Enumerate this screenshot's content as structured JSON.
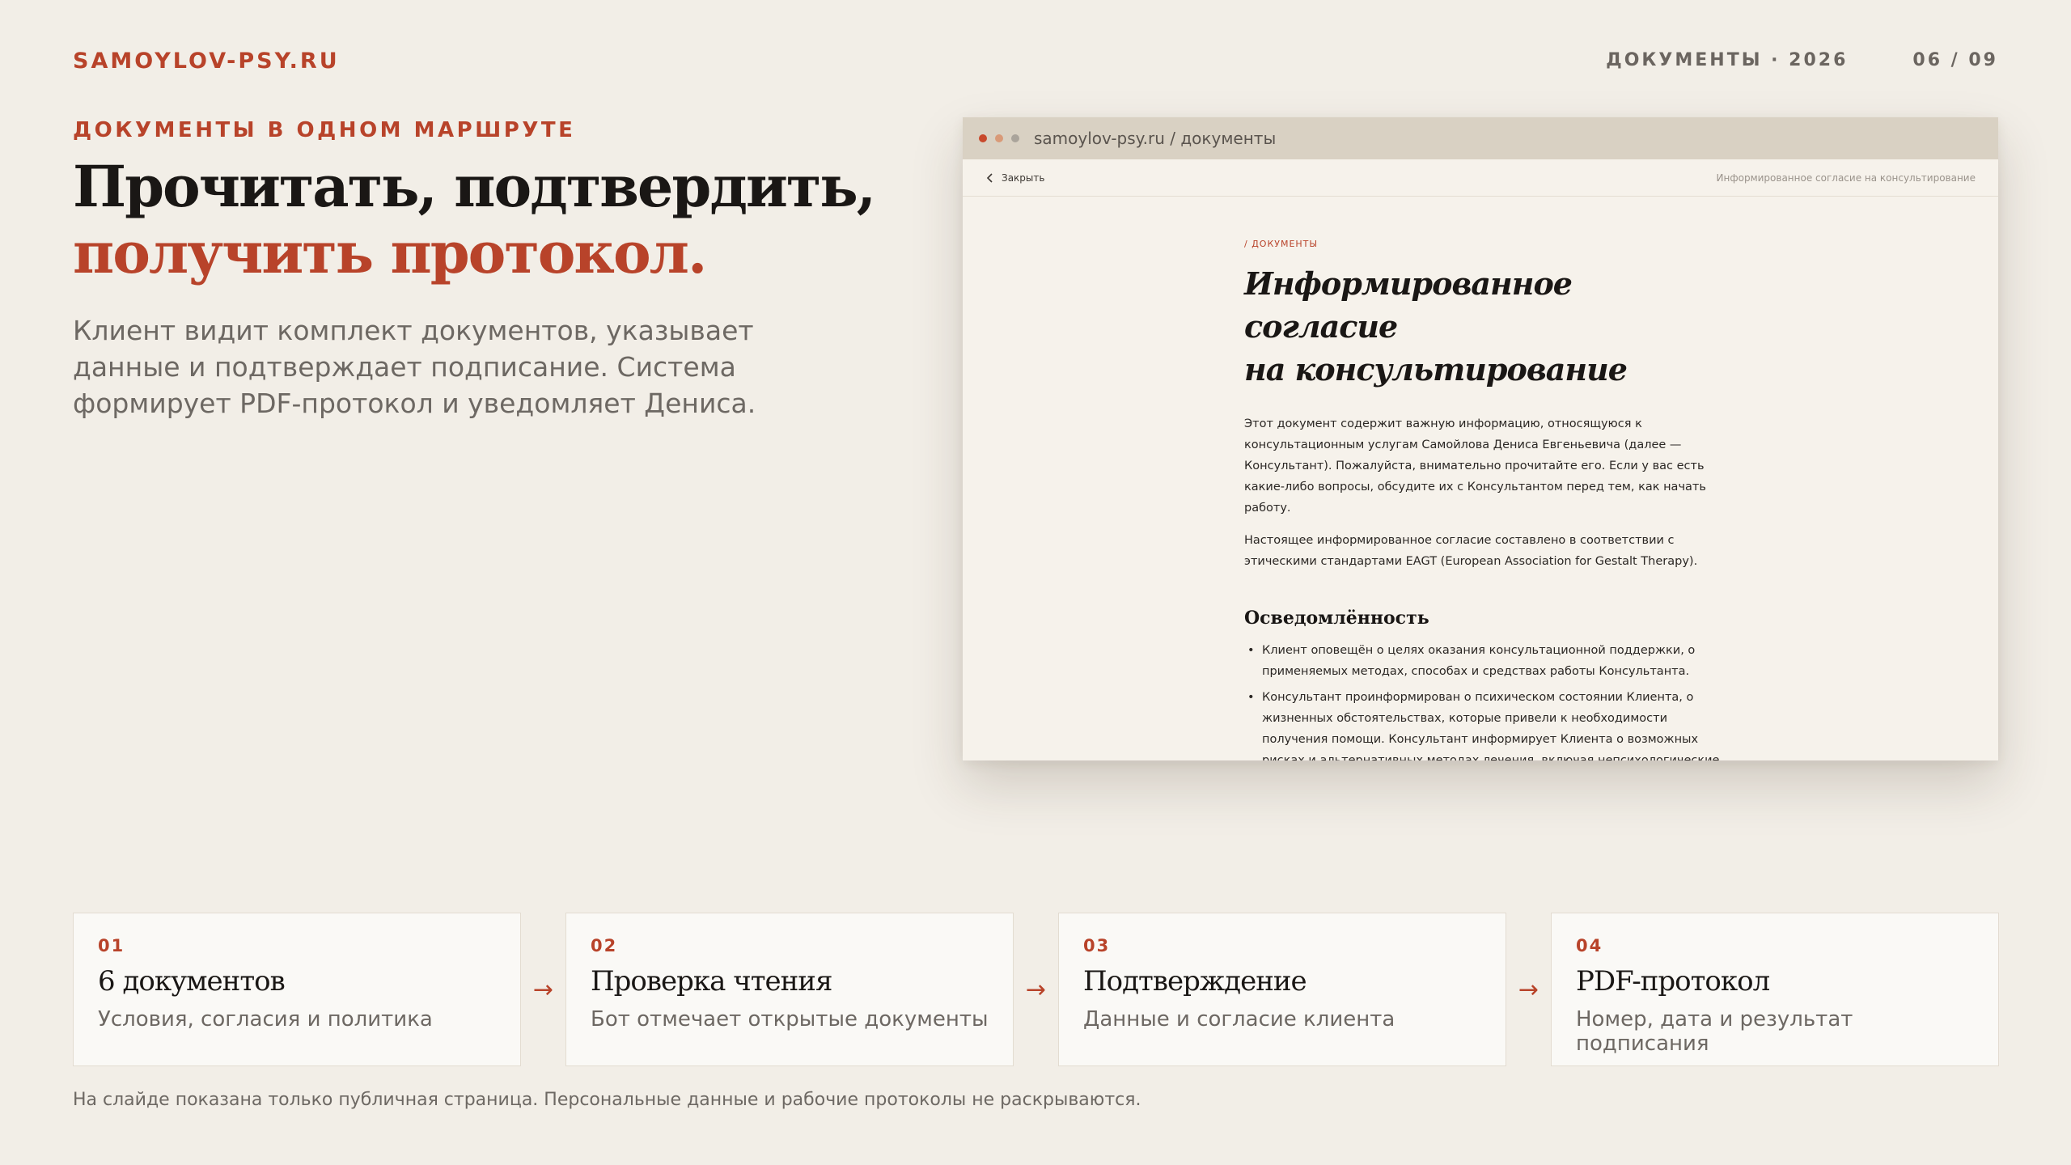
{
  "header": {
    "brand": "SAMOYLOV-PSY.RU",
    "section": "ДОКУМЕНТЫ · 2026",
    "page_counter": "06 / 09"
  },
  "hero": {
    "eyebrow": "ДОКУМЕНТЫ В ОДНОМ МАРШРУТЕ",
    "title_line1": "Прочитать, подтвердить,",
    "title_line2": "получить протокол.",
    "lead": "Клиент видит комплект документов, указывает данные и подтверждает подписание. Система формирует PDF-протокол и уведомляет Дениса."
  },
  "browser": {
    "url": "samoylov-psy.ru / документы",
    "close_label": "Закрыть",
    "doc_name": "Информированное согласие на консультирование",
    "doc": {
      "kicker": "/ ДОКУМЕНТЫ",
      "title_line1": "Информированное согласие",
      "title_line2": "на консультирование",
      "paragraph1": "Этот документ содержит важную информацию, относящуюся к консультационным услугам Самойлова Дениса Евгеньевича (далее — Консультант). Пожалуйста, внимательно прочитайте его. Если у вас есть какие-либо вопросы, обсудите их с Консультантом перед тем, как начать работу.",
      "paragraph2": "Настоящее информированное согласие составлено в соответствии с этическими стандартами EAGT (European Association for Gestalt Therapy).",
      "section_heading": "Осведомлённость",
      "bullets": [
        "Клиент оповещён о целях оказания консультационной поддержки, о применяемых методах, способах и средствах работы Консультанта.",
        "Консультант проинформирован о психическом состоянии Клиента, о жизненных обстоятельствах, которые привели к необходимости получения помощи. Консультант информирует Клиента о возможных рисках и альтернативных методах лечения, включая непсихологические."
      ]
    }
  },
  "steps": [
    {
      "num": "01",
      "title": "6 документов",
      "desc": "Условия, согласия и политика"
    },
    {
      "num": "02",
      "title": "Проверка чтения",
      "desc": "Бот отмечает открытые документы"
    },
    {
      "num": "03",
      "title": "Подтверждение",
      "desc": "Данные и согласие клиента"
    },
    {
      "num": "04",
      "title": "PDF-протокол",
      "desc": "Номер, дата и результат подписания"
    }
  ],
  "arrow_glyph": "→",
  "footnote": "На слайде показана только публичная страница. Персональные данные и рабочие протоколы не раскрываются.",
  "colors": {
    "accent": "#b8432a",
    "background": "#f2eee7",
    "card": "#faf9f6"
  }
}
